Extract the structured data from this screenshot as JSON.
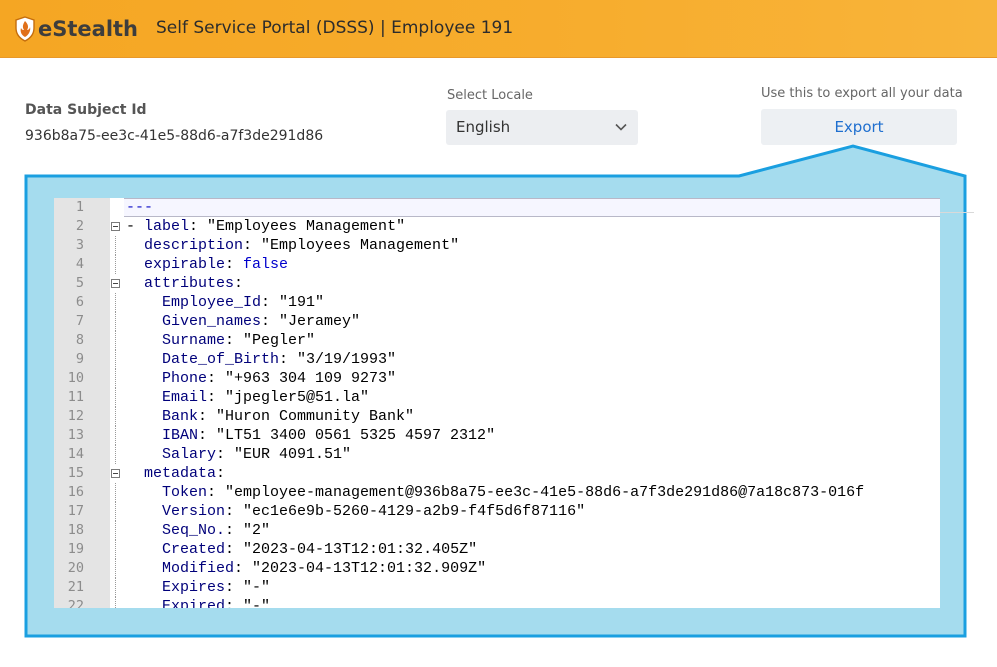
{
  "header": {
    "logo_text": "eStealth",
    "title": "Self Service Portal (DSSS) | Employee 191"
  },
  "subject": {
    "label": "Data Subject Id",
    "value": "936b8a75-ee3c-41e5-88d6-a7f3de291d86"
  },
  "locale": {
    "label": "Select Locale",
    "value": "English"
  },
  "export": {
    "hint": "Use this to export all your data",
    "button_label": "Export"
  },
  "colors": {
    "header": "#f5a623",
    "callout": "#a5dcee",
    "callout_border": "#1a9fe0",
    "link": "#1f6fcf"
  },
  "editor": {
    "lines": [
      {
        "n": "1",
        "key": "",
        "text": "---"
      },
      {
        "n": "2",
        "key": "- label",
        "text": ": \"Employees Management\""
      },
      {
        "n": "3",
        "key": "  description",
        "text": ": \"Employees Management\""
      },
      {
        "n": "4",
        "key": "  expirable",
        "text": ": false"
      },
      {
        "n": "5",
        "key": "  attributes",
        "text": ":"
      },
      {
        "n": "6",
        "key": "    Employee_Id",
        "text": ": \"191\""
      },
      {
        "n": "7",
        "key": "    Given_names",
        "text": ": \"Jeramey\""
      },
      {
        "n": "8",
        "key": "    Surname",
        "text": ": \"Pegler\""
      },
      {
        "n": "9",
        "key": "    Date_of_Birth",
        "text": ": \"3/19/1993\""
      },
      {
        "n": "10",
        "key": "    Phone",
        "text": ": \"+963 304 109 9273\""
      },
      {
        "n": "11",
        "key": "    Email",
        "text": ": \"jpegler5@51.la\""
      },
      {
        "n": "12",
        "key": "    Bank",
        "text": ": \"Huron Community Bank\""
      },
      {
        "n": "13",
        "key": "    IBAN",
        "text": ": \"LT51 3400 0561 5325 4597 2312\""
      },
      {
        "n": "14",
        "key": "    Salary",
        "text": ": \"EUR 4091.51\""
      },
      {
        "n": "15",
        "key": "  metadata",
        "text": ":"
      },
      {
        "n": "16",
        "key": "    Token",
        "text": ": \"employee-management@936b8a75-ee3c-41e5-88d6-a7f3de291d86@7a18c873-016f"
      },
      {
        "n": "17",
        "key": "    Version",
        "text": ": \"ec1e6e9b-5260-4129-a2b9-f4f5d6f87116\""
      },
      {
        "n": "18",
        "key": "    Seq_No.",
        "text": ": \"2\""
      },
      {
        "n": "19",
        "key": "    Created",
        "text": ": \"2023-04-13T12:01:32.405Z\""
      },
      {
        "n": "20",
        "key": "    Modified",
        "text": ": \"2023-04-13T12:01:32.909Z\""
      },
      {
        "n": "21",
        "key": "    Expires",
        "text": ": \"-\""
      },
      {
        "n": "22",
        "key": "    Expired",
        "text": ": \"-\""
      }
    ]
  }
}
